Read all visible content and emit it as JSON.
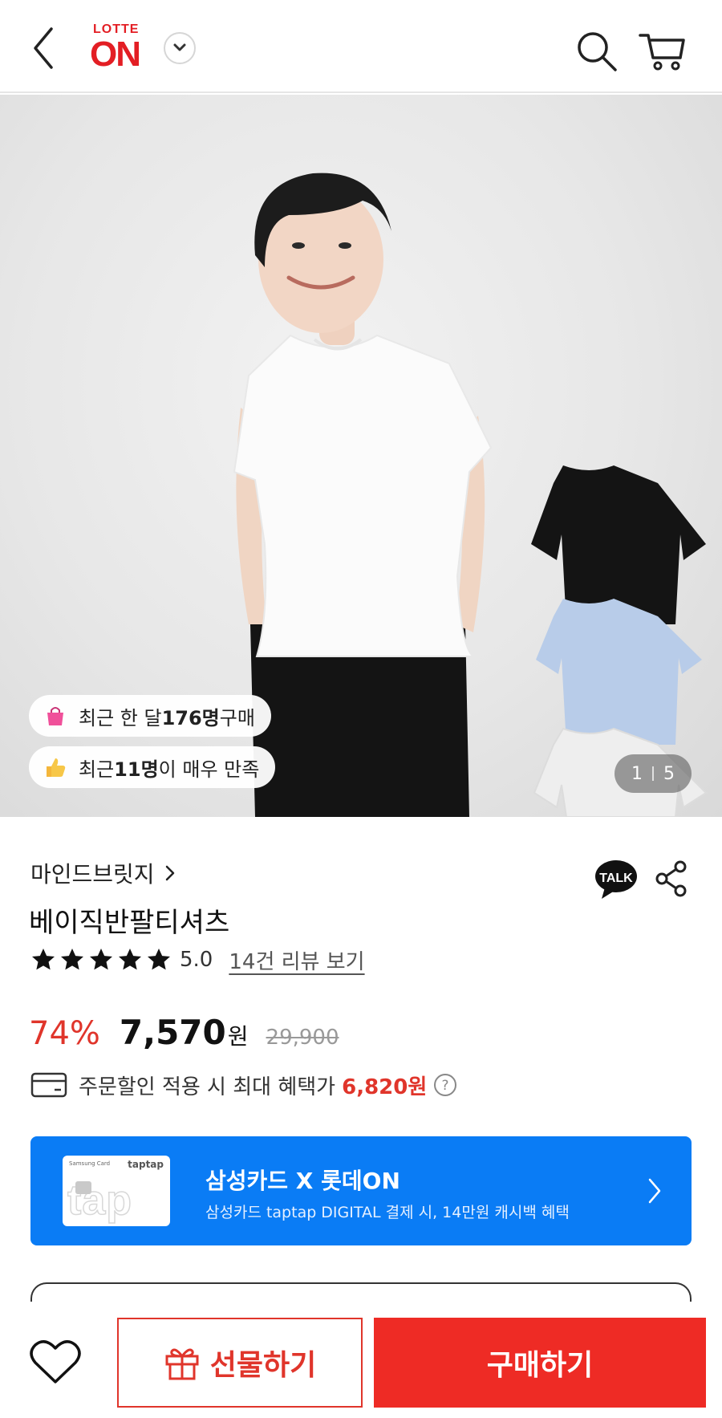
{
  "header": {
    "logo_top": "LOTTE",
    "logo_bottom": "ON"
  },
  "hero": {
    "pill_purchase": {
      "prefix": "최근 한 달 ",
      "count": "176명",
      "suffix": " 구매"
    },
    "pill_satisfaction": {
      "prefix": "최근 ",
      "count": "11명",
      "suffix": "이 매우 만족"
    },
    "counter": {
      "current": "1",
      "total": "5"
    }
  },
  "product": {
    "brand": "마인드브릿지",
    "title": "베이직반팔티셔츠",
    "rating": {
      "value": "5.0",
      "stars": 5,
      "review_link": "14건 리뷰 보기"
    },
    "talk_label": "TALK",
    "price": {
      "discount": "74%",
      "current": "7,570",
      "currency": "원",
      "original": "29,900"
    },
    "benefit": {
      "text": "주문할인 적용 시 최대 혜택가",
      "amount": "6,820원"
    }
  },
  "banner": {
    "title": "삼성카드 X 롯데ON",
    "subtitle": "삼성카드 taptap DIGITAL 결제 시, 14만원 캐시백 혜택",
    "card_brand": "taptap",
    "card_name": "Samsung Card",
    "card_text": "tap",
    "color": "#0a7cf5"
  },
  "bottom_bar": {
    "gift_label": "선물하기",
    "buy_label": "구매하기",
    "accent": "#ee2b25"
  }
}
